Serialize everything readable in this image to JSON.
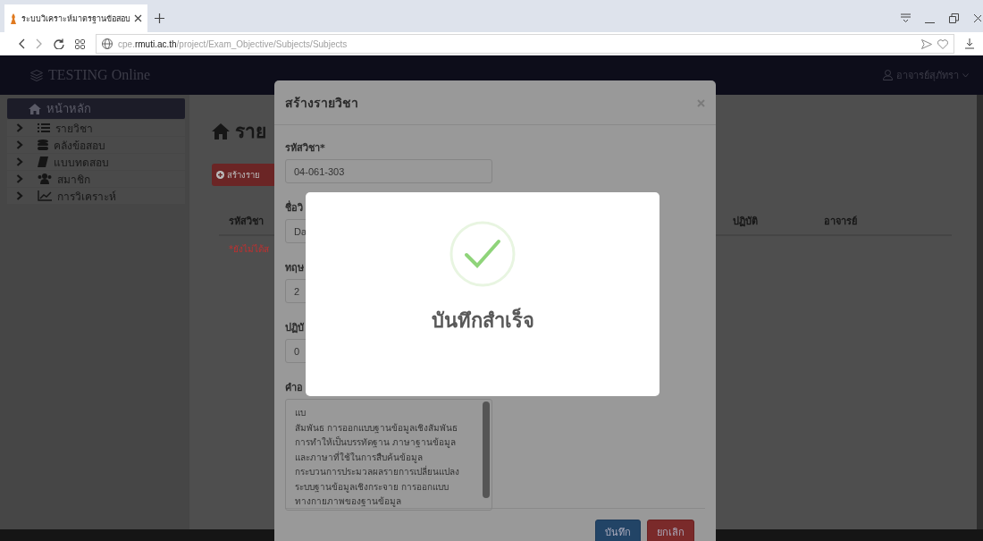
{
  "browser": {
    "tab": {
      "title": "ระบบวิเคราะห์มาตรฐานข้อสอบ"
    },
    "url": {
      "subdomain": "cpe.",
      "domain": "rmuti.ac.th",
      "path": "/project/Exam_Objective/Subjects/Subjects"
    }
  },
  "navbar": {
    "brand": "TESTING Online",
    "user": "อาจารย์สุภัทรา"
  },
  "sidebar": {
    "items": [
      {
        "label": "หน้าหลัก",
        "selected": true,
        "kind": "home"
      },
      {
        "label": "รายวิชา",
        "selected": false,
        "kind": "list"
      },
      {
        "label": "คลังข้อสอบ",
        "selected": false,
        "kind": "database"
      },
      {
        "label": "แบบทดสอบ",
        "selected": false,
        "kind": "book"
      },
      {
        "label": "สมาชิก",
        "selected": false,
        "kind": "users"
      },
      {
        "label": "การวิเคราะห์",
        "selected": false,
        "kind": "chart"
      }
    ]
  },
  "main": {
    "page_title": "ราย",
    "create_button": "สร้างราย",
    "table": {
      "columns": [
        "รหัสวิชา",
        "ปฏิบัติ",
        "อาจารย์"
      ],
      "rows": [
        {
          "note": "*ยังไม่ได้ส"
        }
      ]
    }
  },
  "modal": {
    "title": "สร้างรายวิชา",
    "fields": [
      {
        "label": "รหัสวิชา*",
        "value": "04-061-303",
        "kind": "input"
      },
      {
        "label": "ชื่อวิ",
        "value": "Da",
        "kind": "input"
      },
      {
        "label": "ทฤษ",
        "value": "2",
        "kind": "input"
      },
      {
        "label": "ปฏิบั",
        "value": "0",
        "kind": "input"
      },
      {
        "label": "คำอ",
        "value": "แบ\nสัมพันธ การออกแบบฐานข้อมูลเชิงสัมพันธ\nการทำให้เป็นบรรทัดฐาน ภาษาฐานข้อมูล\nและภาษาที่ใช้ในการสืบค้นข้อมูล\nกระบวนการประมวลผลรายการเปลี่ยนแปลง\nระบบฐานข้อมูลเชิงกระจาย การออกแบบ\nทางกายภาพของฐานข้อมูล",
        "kind": "textarea"
      }
    ],
    "buttons": [
      {
        "label": "บันทึก",
        "kind": "primary"
      },
      {
        "label": "ยกเลิก",
        "kind": "danger"
      }
    ]
  },
  "dialog": {
    "message": "บันทึกสำเร็จ"
  }
}
